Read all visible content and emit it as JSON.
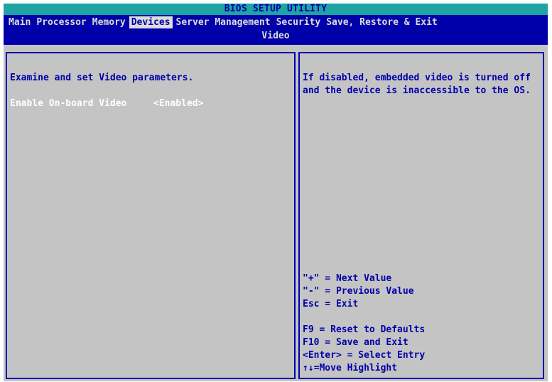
{
  "title": "BIOS SETUP UTILITY",
  "menu": {
    "items": [
      {
        "label": "Main",
        "active": false
      },
      {
        "label": "Processor",
        "active": false
      },
      {
        "label": "Memory",
        "active": false
      },
      {
        "label": "Devices",
        "active": true
      },
      {
        "label": "Server Management",
        "active": false
      },
      {
        "label": "Security",
        "active": false
      },
      {
        "label": "Save, Restore & Exit",
        "active": false
      }
    ],
    "page_title": "Video"
  },
  "left_pane": {
    "description": "Examine and set Video parameters.",
    "option": {
      "label": "Enable On-board Video",
      "value": "<Enabled>"
    }
  },
  "right_pane": {
    "help_text": [
      "If disabled, embedded video is turned off",
      "and the device is inaccessible to the OS."
    ],
    "keys": [
      "\"+\" = Next Value",
      "\"-\" = Previous Value",
      "Esc = Exit",
      "",
      "F9 = Reset to Defaults",
      "F10 = Save and Exit",
      "<Enter> = Select Entry",
      "↑↓=Move Highlight"
    ]
  },
  "colors": {
    "title_bar": "#1fa3a3",
    "menu_bar": "#0000aa",
    "panel_bg": "#c4c4c4",
    "text_blue": "#0000aa",
    "text_white": "#ffffff"
  }
}
